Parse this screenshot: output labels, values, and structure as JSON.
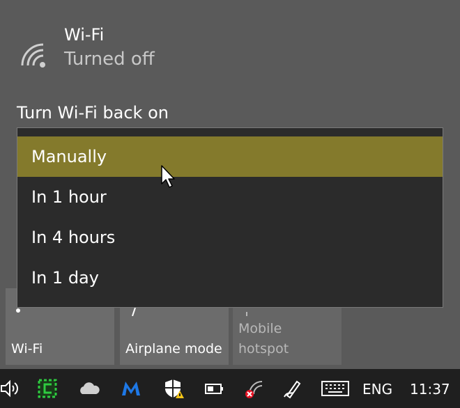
{
  "wifi": {
    "title": "Wi-Fi",
    "status": "Turned off"
  },
  "turn_on_label": "Turn Wi-Fi back on",
  "dropdown": {
    "options": [
      "Manually",
      "In 1 hour",
      "In 4 hours",
      "In 1 day"
    ],
    "selected": "Manually",
    "highlight_color": "#847a2c"
  },
  "tiles": [
    {
      "label": "Wi-Fi",
      "icon": "wifi-icon"
    },
    {
      "label": "Airplane mode",
      "icon": "airplane-icon"
    },
    {
      "label_line1": "Mobile",
      "label_line2": "hotspot",
      "icon": "hotspot-icon",
      "disabled": true
    }
  ],
  "taskbar": {
    "icons": [
      "volume-icon",
      "green-app-icon",
      "onedrive-icon",
      "malwarebytes-icon",
      "security-shield-icon",
      "battery-icon",
      "network-off-icon",
      "pen-icon",
      "touch-keyboard-icon"
    ],
    "language": "ENG",
    "time": "11:37"
  }
}
